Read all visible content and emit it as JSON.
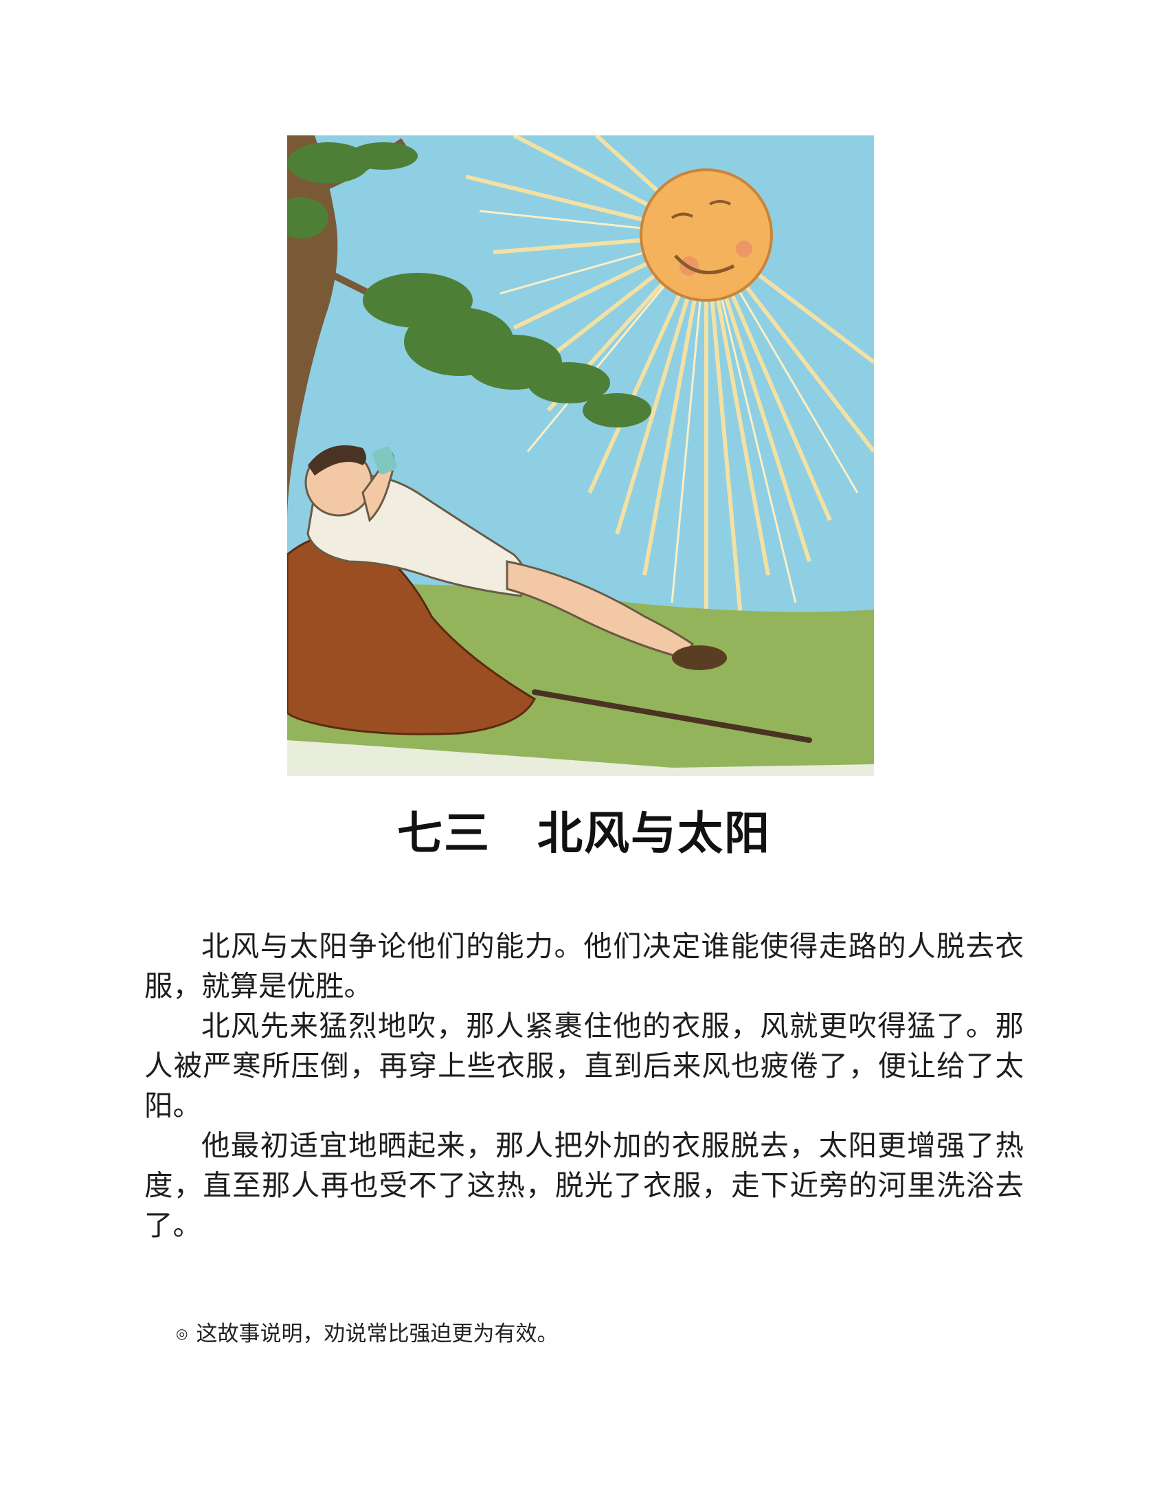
{
  "illustration": {
    "icon": "sun-and-traveler-illustration",
    "colors": {
      "sky": "#8ecfe4",
      "sun": "#f4b25c",
      "rays": "#f9e3a0",
      "grass": "#93b45a",
      "leaves": "#4e7f36",
      "trunk": "#7a5a36",
      "cloak": "#9a4e22",
      "tunic": "#f1ede1"
    }
  },
  "title": "七三　北风与太阳",
  "story": {
    "paragraphs": [
      "北风与太阳争论他们的能力。他们决定谁能使得走路的人脱去衣服，就算是优胜。",
      "北风先来猛烈地吹，那人紧裹住他的衣服，风就更吹得猛了。那人被严寒所压倒，再穿上些衣服，直到后来风也疲倦了，便让给了太阳。",
      "他最初适宜地晒起来，那人把外加的衣服脱去，太阳更增强了热度，直至那人再也受不了这热，脱光了衣服，走下近旁的河里洗浴去了。"
    ]
  },
  "moral": {
    "bullet": "◎",
    "text": "这故事说明，劝说常比强迫更为有效。"
  }
}
